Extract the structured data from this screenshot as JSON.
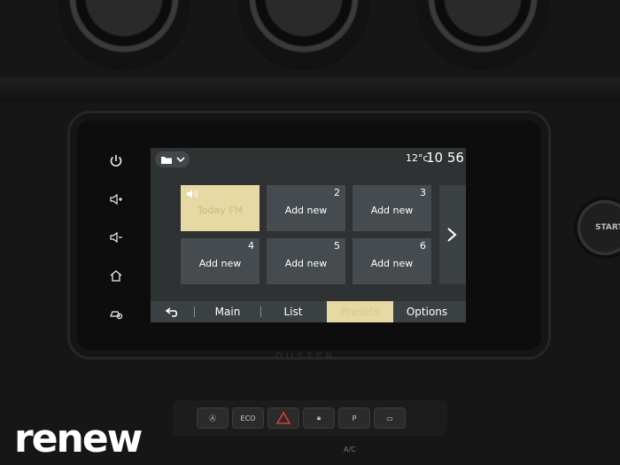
{
  "status": {
    "temperature": "12°c",
    "time": "10 56"
  },
  "presets": [
    {
      "number": "",
      "label": "Today FM",
      "active": true
    },
    {
      "number": "2",
      "label": "Add new",
      "active": false
    },
    {
      "number": "3",
      "label": "Add new",
      "active": false
    },
    {
      "number": "4",
      "label": "Add new",
      "active": false
    },
    {
      "number": "5",
      "label": "Add new",
      "active": false
    },
    {
      "number": "6",
      "label": "Add new",
      "active": false
    }
  ],
  "bottom_bar": {
    "main": "Main",
    "list": "List",
    "presets": "Presets",
    "options": "Options"
  },
  "side_buttons": [
    "power-icon",
    "volume-up-icon",
    "volume-down-icon",
    "home-icon",
    "settings-car-icon"
  ],
  "console": {
    "eco": "ECO",
    "ac": "A/C"
  },
  "bezel_text": "DUSTER",
  "start_text": "START",
  "brand": "renew",
  "colors": {
    "accent": "#e6d9a3",
    "tile": "#454b4f",
    "screen_bg": "#2f3233"
  }
}
